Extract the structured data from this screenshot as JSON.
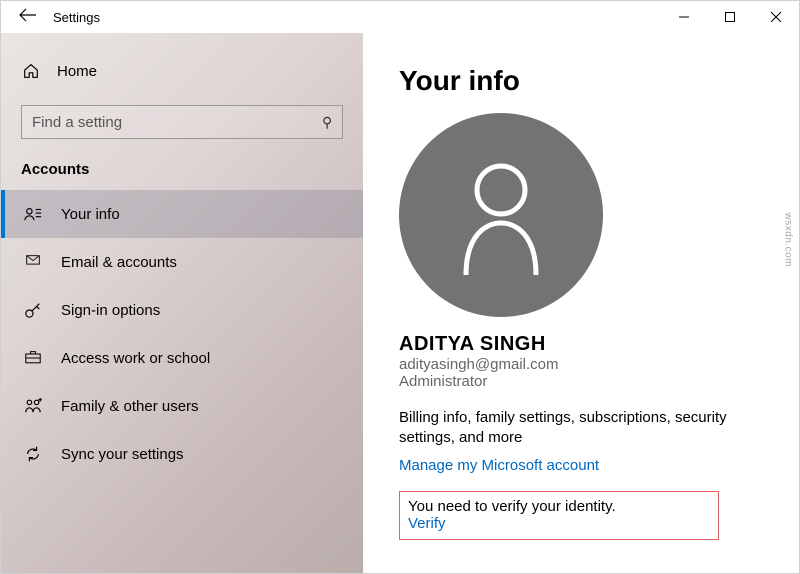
{
  "window": {
    "title": "Settings"
  },
  "sidebar": {
    "home": "Home",
    "search_placeholder": "Find a setting",
    "category": "Accounts",
    "items": [
      {
        "label": "Your info"
      },
      {
        "label": "Email & accounts"
      },
      {
        "label": "Sign-in options"
      },
      {
        "label": "Access work or school"
      },
      {
        "label": "Family & other users"
      },
      {
        "label": "Sync your settings"
      }
    ]
  },
  "main": {
    "title": "Your info",
    "user_name": "ADITYA SINGH",
    "user_email": "adityasingh@gmail.com",
    "user_role": "Administrator",
    "billing_text": "Billing info, family settings, subscriptions, security settings, and more",
    "manage_link": "Manage my Microsoft account",
    "verify_text": "You need to verify your identity.",
    "verify_link": "Verify"
  },
  "watermark": "wsxdn.com"
}
